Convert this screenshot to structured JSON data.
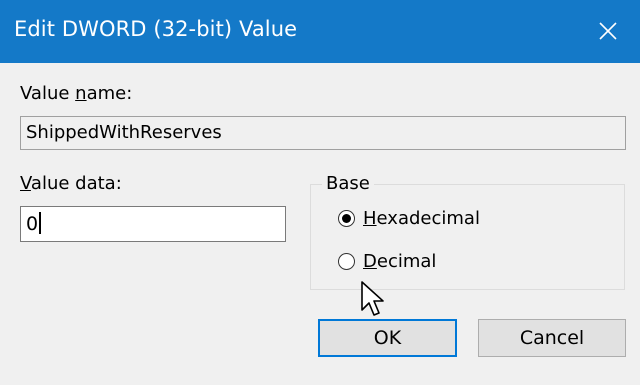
{
  "dialog": {
    "title": "Edit DWORD (32-bit) Value",
    "close_icon": "close-icon"
  },
  "value_name": {
    "label_pre": "Value ",
    "label_mnemonic": "n",
    "label_post": "ame:",
    "value": "ShippedWithReserves"
  },
  "value_data": {
    "label_mnemonic": "V",
    "label_post": "alue data:",
    "value": "0"
  },
  "base": {
    "legend": "Base",
    "options": [
      {
        "mnemonic": "H",
        "rest": "exadecimal",
        "selected": true
      },
      {
        "mnemonic": "D",
        "rest": "ecimal",
        "selected": false
      }
    ]
  },
  "buttons": {
    "ok": "OK",
    "cancel": "Cancel"
  },
  "colors": {
    "titlebar": "#1479c8",
    "accent": "#0078d7"
  }
}
